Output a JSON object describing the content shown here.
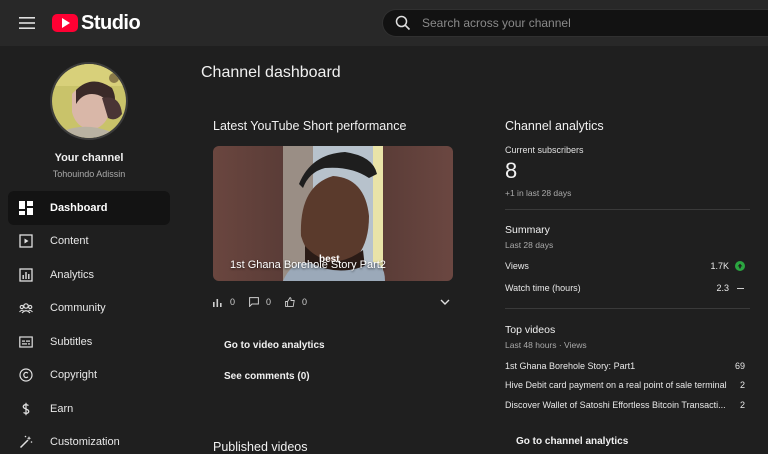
{
  "app": {
    "logo_text": "Studio",
    "brand_color": "#ff0033"
  },
  "search": {
    "placeholder": "Search across your channel"
  },
  "sidebar": {
    "channel_heading": "Your channel",
    "channel_name": "Tohouindo Adissin",
    "items": [
      {
        "label": "Dashboard",
        "icon": "dashboard-icon",
        "active": true
      },
      {
        "label": "Content",
        "icon": "content-icon"
      },
      {
        "label": "Analytics",
        "icon": "analytics-icon"
      },
      {
        "label": "Community",
        "icon": "community-icon"
      },
      {
        "label": "Subtitles",
        "icon": "subtitles-icon"
      },
      {
        "label": "Copyright",
        "icon": "copyright-icon"
      },
      {
        "label": "Earn",
        "icon": "earn-icon"
      },
      {
        "label": "Customization",
        "icon": "customization-icon"
      }
    ]
  },
  "main": {
    "page_title": "Channel dashboard",
    "short_card": {
      "title": "Latest YouTube Short performance",
      "video_title": "1st Ghana Borehole Story Part2",
      "caption_word": "best",
      "views": "0",
      "comments": "0",
      "likes": "0",
      "go_to_analytics": "Go to video analytics",
      "see_comments": "See comments (0)"
    },
    "published_title": "Published videos",
    "analytics_card": {
      "title": "Channel analytics",
      "subscribers_label": "Current subscribers",
      "subscribers_count": "8",
      "subscribers_delta": "+1 in last 28 days",
      "summary_title": "Summary",
      "summary_period": "Last 28 days",
      "metrics": [
        {
          "label": "Views",
          "value": "1.7K",
          "trend": "up"
        },
        {
          "label": "Watch time (hours)",
          "value": "2.3",
          "trend": "flat"
        }
      ],
      "top_videos_title": "Top videos",
      "top_videos_period": "Last 48 hours · Views",
      "top_videos": [
        {
          "title": "1st Ghana Borehole Story: Part1",
          "views": "69"
        },
        {
          "title": "Hive Debit card payment on a real point of sale terminal",
          "views": "2"
        },
        {
          "title": "Discover Wallet of Satoshi Effortless Bitcoin Transacti...",
          "views": "2"
        }
      ],
      "go_to_channel_analytics": "Go to channel analytics"
    }
  }
}
